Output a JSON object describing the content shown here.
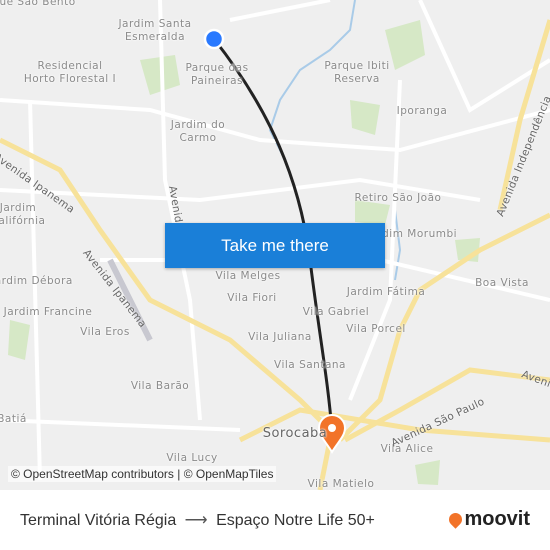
{
  "map": {
    "labels": [
      "Parque São Bento",
      "Jardim Santa Esmeralda",
      "Residencial Horto Florestal I",
      "Parque das Paineiras",
      "Parque Ibiti Reserva",
      "Iporanga",
      "Jardim do Carmo",
      "Retiro São João",
      "Jardim Morumbi",
      "Jardim Califórnia",
      "Jardim Débora",
      "Jardim Francine",
      "Vila Eros",
      "Vila Melges",
      "Vila Fiori",
      "Jardim Fátima",
      "Boa Vista",
      "Vila Gabriel",
      "Vila Porcel",
      "Vila Juliana",
      "Vila Santana",
      "Vila Barão",
      "Vila Alice",
      "Vila Lucy",
      "Vila Matielo",
      "Sorocaba",
      "Batiá"
    ],
    "roads": [
      "Avenida Ipanema",
      "Avenida Ipanema",
      "Avenida Independência",
      "Avenida São Paulo",
      "Avenida",
      "Avenida"
    ],
    "origin_color": "#2979ff",
    "destination_color": "#f27329",
    "route_color": "#222222"
  },
  "cta": {
    "label": "Take me there"
  },
  "attribution": "© OpenStreetMap contributors | © OpenMapTiles",
  "footer": {
    "origin": "Terminal Vitória Régia",
    "arrow": "⟶",
    "destination": "Espaço Notre Life 50+",
    "brand": "moovit"
  }
}
